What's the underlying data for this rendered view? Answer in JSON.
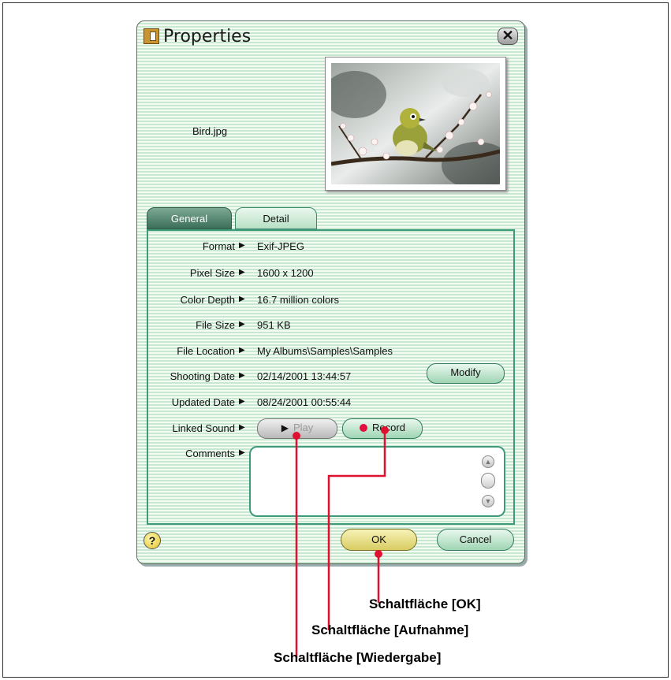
{
  "window": {
    "title": "Properties",
    "close_label": "✕"
  },
  "file": {
    "name": "Bird.jpg"
  },
  "tabs": [
    {
      "label": "General",
      "active": true
    },
    {
      "label": "Detail",
      "active": false
    }
  ],
  "properties": [
    {
      "label": "Format",
      "value": "Exif-JPEG"
    },
    {
      "label": "Pixel Size",
      "value": "1600 x 1200"
    },
    {
      "label": "Color Depth",
      "value": "16.7 million colors"
    },
    {
      "label": "File Size",
      "value": "951 KB"
    },
    {
      "label": "File Location",
      "value": "My Albums\\Samples\\Samples"
    },
    {
      "label": "Shooting Date",
      "value": "02/14/2001 13:44:57"
    },
    {
      "label": "Updated Date",
      "value": "08/24/2001 00:55:44"
    },
    {
      "label": "Linked Sound",
      "value": ""
    },
    {
      "label": "Comments",
      "value": ""
    }
  ],
  "buttons": {
    "modify": "Modify",
    "play": "Play",
    "record": "Record",
    "ok": "OK",
    "cancel": "Cancel",
    "help": "?"
  },
  "callouts": {
    "ok": "Schaltfläche [OK]",
    "record": "Schaltfläche [Aufnahme]",
    "play": "Schaltfläche [Wiedergabe]"
  },
  "colors": {
    "accent": "#3e9a7b",
    "callout_line": "#e01030",
    "record_dot": "#e01040"
  }
}
